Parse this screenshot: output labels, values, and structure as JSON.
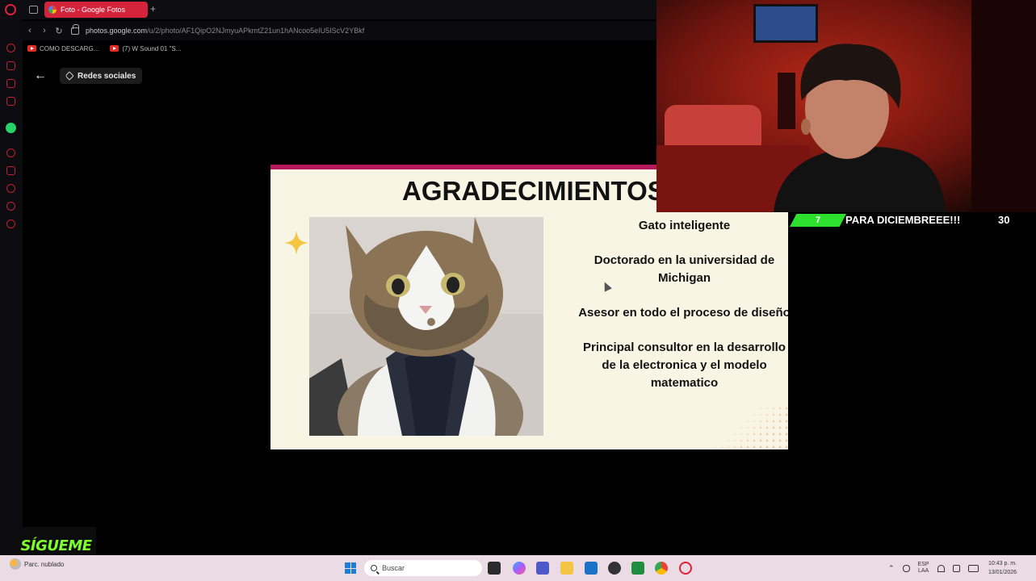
{
  "browser": {
    "tab_title": "Foto - Google Fotos",
    "new_tab_label": "+",
    "url_domain": "photos.google.com",
    "url_path": "/u/2/photo/AF1QipO2NJmyuAPkmtZ21un1hANcoo5eIU5IScV2YBkf",
    "bookmarks": [
      "COMO DESCARG...",
      "(7) W Sound 01 \"S..."
    ]
  },
  "viewer": {
    "back_icon": "←",
    "album_label": "Redes sociales"
  },
  "slide": {
    "title": "AGRADECIMIENTOS",
    "lines": [
      "Gato inteligente",
      "Doctorado en la universidad de Michigan",
      "Asesor en todo el proceso de diseño",
      "Principal consultor en la desarrollo de la electronica y el modelo matematico"
    ]
  },
  "overlay": {
    "ticker_badge": "7",
    "ticker_text": "PARA DICIEMBREEE!!!",
    "ticker_count": "30",
    "sigueme": "SÍGUEME"
  },
  "taskbar": {
    "weather": "Parc. nublado",
    "search_placeholder": "Buscar",
    "lang_top": "ESP",
    "lang_bottom": "LAA",
    "time": "10:43 p. m.",
    "date": "13/01/2026",
    "colors": {
      "accent": "#d3243c",
      "ticker_green": "#2de02d"
    }
  }
}
